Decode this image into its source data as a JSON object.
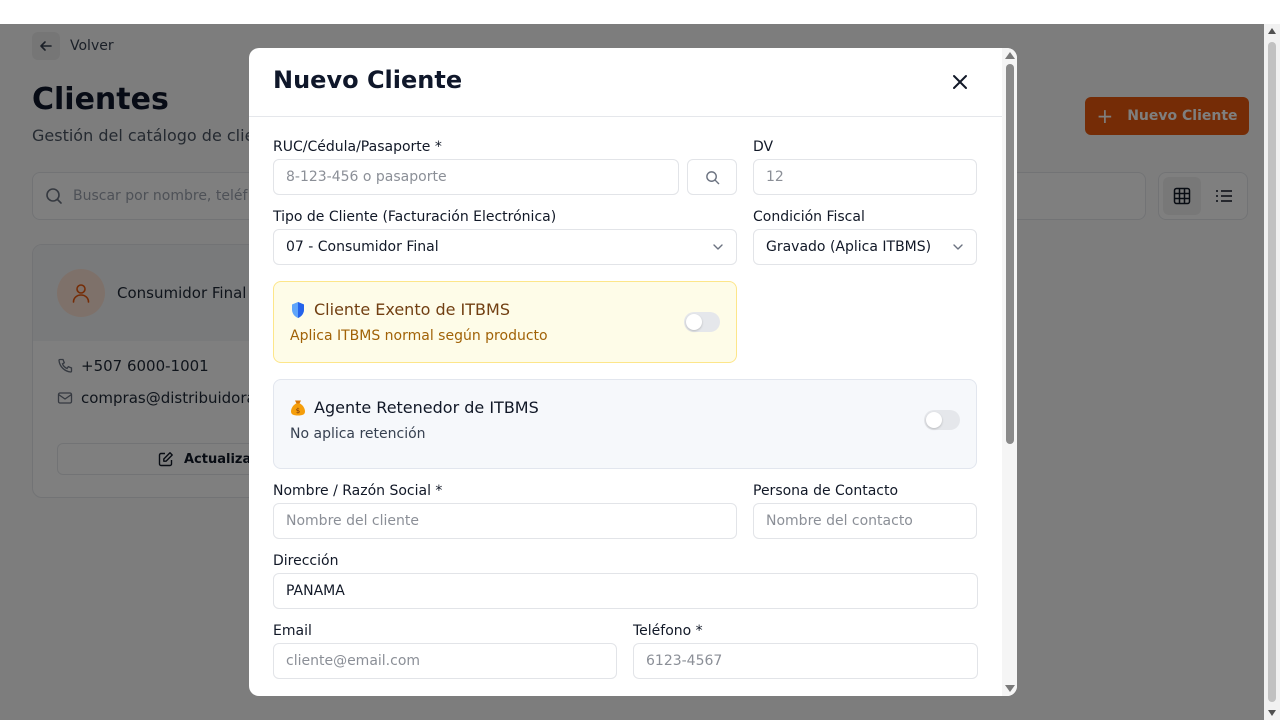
{
  "background": {
    "back_label": "Volver",
    "title": "Clientes",
    "subtitle": "Gestión del catálogo de clie",
    "new_client_button": "Nuevo Cliente",
    "search_placeholder": "Buscar por nombre, teléf",
    "card": {
      "name": "Consumidor Final",
      "phone": "+507 6000-1001",
      "email": "compras@distribuidora",
      "update_button": "Actualizar"
    }
  },
  "modal": {
    "title": "Nuevo Cliente",
    "ruc": {
      "label": "RUC/Cédula/Pasaporte *",
      "placeholder": "8-123-456 o pasaporte"
    },
    "dv": {
      "label": "DV",
      "placeholder": "12"
    },
    "client_type": {
      "label": "Tipo de Cliente (Facturación Electrónica)",
      "value": "07 - Consumidor Final"
    },
    "fiscal_condition": {
      "label": "Condición Fiscal",
      "value": "Gravado (Aplica ITBMS)"
    },
    "exempt": {
      "title": "Cliente Exento de ITBMS",
      "description": "Aplica ITBMS normal según producto",
      "enabled": false
    },
    "retainer": {
      "title": "Agente Retenedor de ITBMS",
      "description": "No aplica retención",
      "enabled": false
    },
    "name": {
      "label": "Nombre / Razón Social *",
      "placeholder": "Nombre del cliente"
    },
    "contact": {
      "label": "Persona de Contacto",
      "placeholder": "Nombre del contacto"
    },
    "address": {
      "label": "Dirección",
      "value": "PANAMA"
    },
    "email": {
      "label": "Email",
      "placeholder": "cliente@email.com"
    },
    "phone": {
      "label": "Teléfono *",
      "placeholder": "6123-4567"
    }
  },
  "colors": {
    "accent": "#ea580c",
    "exempt_bg": "#fefce8",
    "exempt_title": "#713f12",
    "exempt_desc": "#a16207",
    "retainer_bg": "#f6f8fb"
  }
}
